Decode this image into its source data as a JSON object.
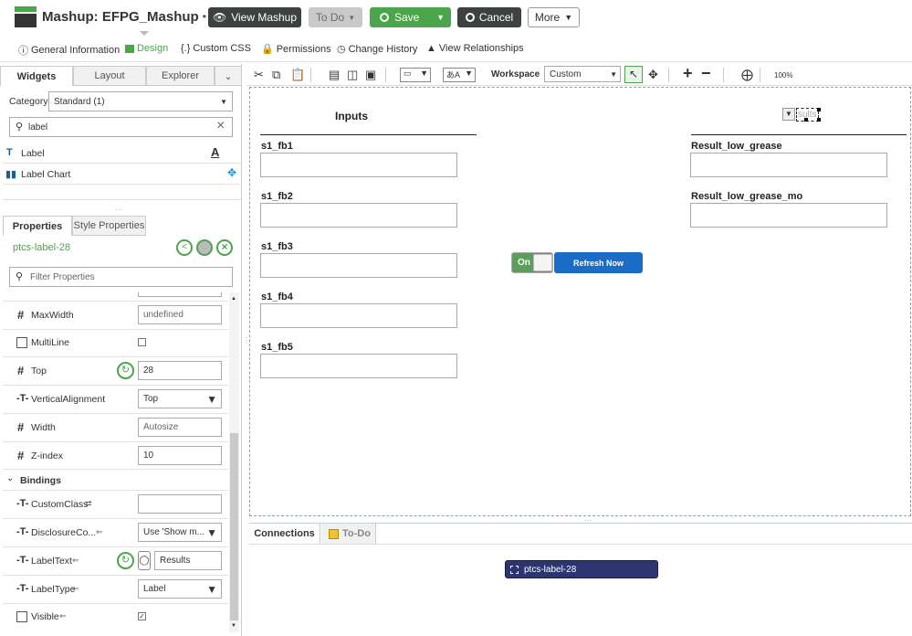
{
  "header": {
    "title": "Mashup: EFPG_Mashup",
    "dirty_marker": "*",
    "help": "?",
    "view_mashup": "View Mashup",
    "todo": "To Do",
    "save": "Save",
    "cancel": "Cancel",
    "more": "More"
  },
  "tabs": [
    {
      "label": "General Information"
    },
    {
      "label": "Design"
    },
    {
      "label": "Custom CSS"
    },
    {
      "label": "Permissions"
    },
    {
      "label": "Change History"
    },
    {
      "label": "View Relationships"
    }
  ],
  "left_panel": {
    "tabs": [
      "Widgets",
      "Layout",
      "Explorer"
    ],
    "category_label": "Category",
    "category_value": "Standard (1)",
    "search_value": "label",
    "widgets": [
      {
        "label": "Label"
      },
      {
        "label": "Label Chart"
      }
    ],
    "prop_tabs": [
      "Properties",
      "Style Properties"
    ],
    "selected_widget": "ptcs-label-28",
    "filter_placeholder": "Filter Properties",
    "properties": [
      {
        "name": "MaxWidth",
        "value": "undefined"
      },
      {
        "name": "MultiLine",
        "value": ""
      },
      {
        "name": "Top",
        "value": "28"
      },
      {
        "name": "VerticalAlignment",
        "value": "Top"
      },
      {
        "name": "Width",
        "value": "Autosize"
      },
      {
        "name": "Z-index",
        "value": "10"
      }
    ],
    "bindings_label": "Bindings",
    "bindings": [
      {
        "name": "CustomClass",
        "value": ""
      },
      {
        "name": "DisclosureCo...",
        "value": "Use 'Show m..."
      },
      {
        "name": "LabelText",
        "value": "Results"
      },
      {
        "name": "LabelType",
        "value": "Label"
      },
      {
        "name": "Visible",
        "value": ""
      }
    ]
  },
  "toolbar": {
    "workspace_label": "Workspace",
    "workspace_value": "Custom",
    "zoom": "100%"
  },
  "canvas": {
    "inputs_header": "Inputs",
    "results_label": "sults",
    "input_fields": [
      "s1_fb1",
      "s1_fb2",
      "s1_fb3",
      "s1_fb4",
      "s1_fb5"
    ],
    "result_fields": [
      "Result_low_grease",
      "Result_low_grease_mo"
    ],
    "toggle_label": "On",
    "refresh_label": "Refresh Now"
  },
  "bottom": {
    "tabs": [
      "Connections",
      "To-Do"
    ],
    "node_label": "ptcs-label-28"
  }
}
